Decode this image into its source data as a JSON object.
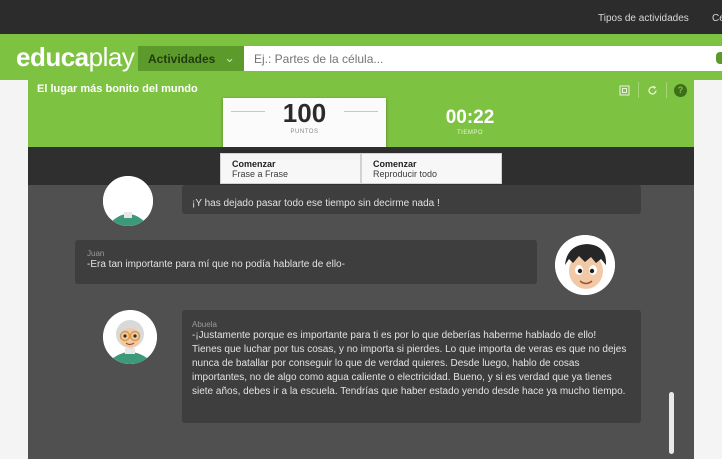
{
  "topbar": {
    "activity_types_link": "Tipos de actividades",
    "cut_link": "Ce"
  },
  "nav": {
    "logo_bold": "educa",
    "logo_light": "play",
    "activities_label": "Actividades",
    "search_placeholder": "Ej.: Partes de la célula..."
  },
  "game": {
    "title": "El lugar más bonito del mundo",
    "score_value": "100",
    "score_label": "PUNTOS",
    "time_value": "00:22",
    "time_label": "TIEMPO",
    "buttons": [
      {
        "title": "Comenzar",
        "subtitle": "Frase a Frase"
      },
      {
        "title": "Comenzar",
        "subtitle": "Reproducir todo"
      }
    ]
  },
  "dialogue": [
    {
      "speaker": "",
      "text": "¡Y has dejado pasar todo ese tiempo sin decirme nada !"
    },
    {
      "speaker": "Juan",
      "text": "-Era tan importante para mí que no podía hablarte de ello-"
    },
    {
      "speaker": "Abuela",
      "text": "-¡Justamente porque es importante para ti es por lo que deberías haberme hablado de ello! Tienes que luchar por tus cosas, y no importa si pierdes. Lo que importa de veras es que no dejes nunca de batallar por conseguir lo que de verdad quieres. Desde luego, hablo de cosas importantes, no de algo como agua caliente o electricidad. Bueno, y si es verdad que ya tienes siete años, debes ir a la escuela. Tendrías que haber estado yendo desde hace ya mucho tiempo."
    }
  ],
  "colors": {
    "brand_green": "#7ec242",
    "dark_green": "#5d9a2c",
    "panel": "#505050",
    "bubble": "#3e3e3e"
  },
  "icons": [
    "chevron-down-icon",
    "fullscreen-icon",
    "restart-icon",
    "help-icon",
    "grandma-avatar",
    "boy-avatar"
  ]
}
